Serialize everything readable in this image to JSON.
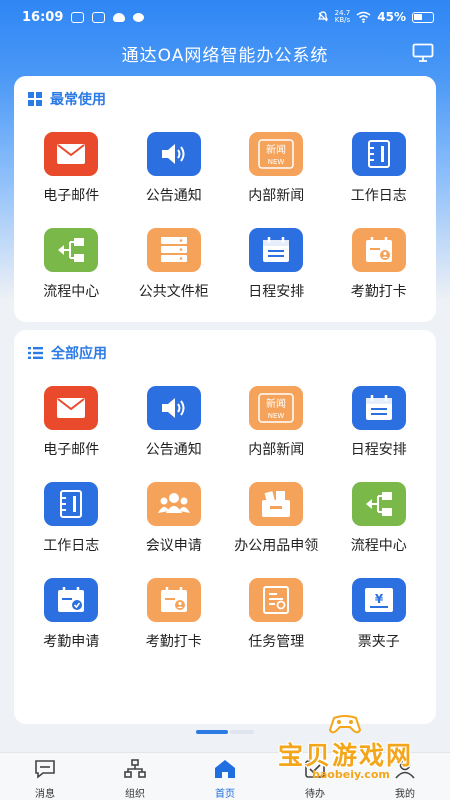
{
  "status_bar": {
    "time": "16:09",
    "net_speed_top": "24.7",
    "net_speed_unit": "KB/s",
    "battery": "45%"
  },
  "header": {
    "title": "通达OA网络智能办公系统"
  },
  "frequent": {
    "title": "最常使用",
    "items": [
      {
        "label": "电子邮件",
        "icon": "mail-icon",
        "color": "#ea4a2c"
      },
      {
        "label": "公告通知",
        "icon": "speaker-icon",
        "color": "#2c6fe0"
      },
      {
        "label": "内部新闻",
        "icon": "news-icon",
        "color": "#f5a35a",
        "icon_text": "新闻",
        "icon_sub": "NEW"
      },
      {
        "label": "工作日志",
        "icon": "journal-icon",
        "color": "#2c6fe0"
      },
      {
        "label": "流程中心",
        "icon": "workflow-icon",
        "color": "#7ab84a"
      },
      {
        "label": "公共文件柜",
        "icon": "cabinet-icon",
        "color": "#f5a35a"
      },
      {
        "label": "日程安排",
        "icon": "schedule-icon",
        "color": "#2c6fe0"
      },
      {
        "label": "考勤打卡",
        "icon": "clock-in-icon",
        "color": "#f5a35a"
      }
    ]
  },
  "all_apps": {
    "title": "全部应用",
    "items": [
      {
        "label": "电子邮件",
        "icon": "mail-icon",
        "color": "#ea4a2c"
      },
      {
        "label": "公告通知",
        "icon": "speaker-icon",
        "color": "#2c6fe0"
      },
      {
        "label": "内部新闻",
        "icon": "news-icon",
        "color": "#f5a35a",
        "icon_text": "新闻",
        "icon_sub": "NEW"
      },
      {
        "label": "日程安排",
        "icon": "schedule-icon",
        "color": "#2c6fe0"
      },
      {
        "label": "工作日志",
        "icon": "journal-icon",
        "color": "#2c6fe0"
      },
      {
        "label": "会议申请",
        "icon": "meeting-icon",
        "color": "#f5a35a"
      },
      {
        "label": "办公用品申领",
        "icon": "supplies-icon",
        "color": "#f5a35a"
      },
      {
        "label": "流程中心",
        "icon": "workflow-icon",
        "color": "#7ab84a"
      },
      {
        "label": "考勤申请",
        "icon": "attendance-request-icon",
        "color": "#2c6fe0"
      },
      {
        "label": "考勤打卡",
        "icon": "clock-in-icon",
        "color": "#f5a35a"
      },
      {
        "label": "任务管理",
        "icon": "task-icon",
        "color": "#f5a35a"
      },
      {
        "label": "票夹子",
        "icon": "ticket-icon",
        "color": "#2c6fe0",
        "icon_text": "¥"
      }
    ]
  },
  "tabbar": {
    "items": [
      {
        "label": "消息",
        "icon": "message-icon",
        "active": false
      },
      {
        "label": "组织",
        "icon": "org-icon",
        "active": false
      },
      {
        "label": "首页",
        "icon": "home-icon",
        "active": true
      },
      {
        "label": "待办",
        "icon": "todo-icon",
        "active": false
      },
      {
        "label": "我的",
        "icon": "profile-icon",
        "active": false
      }
    ],
    "active_color": "#1f6fe0"
  },
  "watermark": {
    "text": "宝贝游戏网",
    "url": "baobeiy.com"
  }
}
